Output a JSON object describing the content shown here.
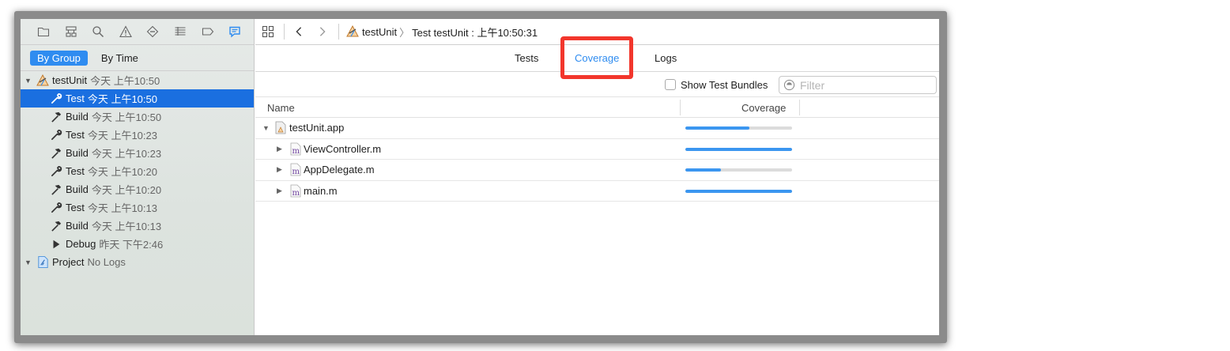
{
  "navigator": {
    "icons": [
      "folder-icon",
      "hierarchy-icon",
      "search-icon",
      "warning-icon",
      "test-diamond-icon",
      "debug-list-icon",
      "breakpoint-icon",
      "report-icon"
    ],
    "segments": [
      {
        "label": "By Group",
        "active": true
      },
      {
        "label": "By Time",
        "active": false
      }
    ],
    "groups": [
      {
        "title": "testUnit",
        "time": "今天 上午10:50",
        "items": [
          {
            "kind": "Test",
            "time": "今天 上午10:50",
            "icon": "wrench-icon",
            "selected": true
          },
          {
            "kind": "Build",
            "time": "今天 上午10:50",
            "icon": "hammer-icon"
          },
          {
            "kind": "Test",
            "time": "今天 上午10:23",
            "icon": "wrench-icon"
          },
          {
            "kind": "Build",
            "time": "今天 上午10:23",
            "icon": "hammer-icon"
          },
          {
            "kind": "Test",
            "time": "今天 上午10:20",
            "icon": "wrench-icon"
          },
          {
            "kind": "Build",
            "time": "今天 上午10:20",
            "icon": "hammer-icon"
          },
          {
            "kind": "Test",
            "time": "今天 上午10:13",
            "icon": "wrench-icon"
          },
          {
            "kind": "Build",
            "time": "今天 上午10:13",
            "icon": "hammer-icon"
          },
          {
            "kind": "Debug",
            "time": "昨天 下午2:46",
            "icon": "play-icon"
          }
        ]
      },
      {
        "title": "Project",
        "time": "No Logs",
        "items": []
      }
    ]
  },
  "jumpbar": {
    "project": "testUnit",
    "report": "Test testUnit : 上午10:50:31"
  },
  "tabs": [
    {
      "label": "Tests",
      "active": false
    },
    {
      "label": "Coverage",
      "active": true
    },
    {
      "label": "Logs",
      "active": false
    }
  ],
  "filter_bar": {
    "show_bundles_label": "Show Test Bundles",
    "show_bundles_checked": false,
    "filter_placeholder": "Filter"
  },
  "table": {
    "columns": [
      "Name",
      "Coverage"
    ],
    "rows": [
      {
        "name": "testUnit.app",
        "coverage": 0.6,
        "expanded": true,
        "type": "app"
      },
      {
        "name": "ViewController.m",
        "coverage": 1.0,
        "expanded": false,
        "type": "m"
      },
      {
        "name": "AppDelegate.m",
        "coverage": 0.33,
        "expanded": false,
        "type": "m"
      },
      {
        "name": "main.m",
        "coverage": 1.0,
        "expanded": false,
        "type": "m"
      }
    ]
  },
  "colors": {
    "accent": "#2f8cf0",
    "selection": "#1a6fe0",
    "highlight_box": "#f2362c",
    "coverage_fill": "#3b96f0"
  }
}
